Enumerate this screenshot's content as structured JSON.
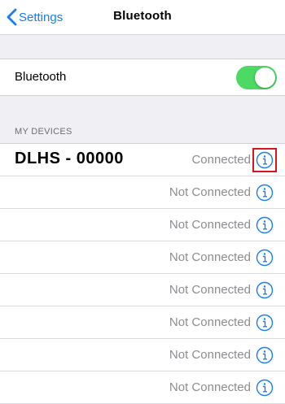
{
  "navbar": {
    "back_label": "Settings",
    "title": "Bluetooth"
  },
  "bluetooth": {
    "label": "Bluetooth",
    "enabled": true
  },
  "devices_section": {
    "header": "MY DEVICES"
  },
  "devices": [
    {
      "name": "DLHS - 00000",
      "status": "Connected",
      "highlighted": true
    },
    {
      "name": "",
      "status": "Not Connected"
    },
    {
      "name": "",
      "status": "Not Connected"
    },
    {
      "name": "",
      "status": "Not Connected"
    },
    {
      "name": "",
      "status": "Not Connected"
    },
    {
      "name": "",
      "status": "Not Connected"
    },
    {
      "name": "",
      "status": "Not Connected"
    },
    {
      "name": "",
      "status": "Not Connected"
    }
  ],
  "colors": {
    "accent": "#1a7cf5",
    "toggle_on": "#4cd964",
    "highlight_box": "#d7151c"
  },
  "icons": {
    "back": "chevron-left-icon",
    "info": "info-icon"
  }
}
